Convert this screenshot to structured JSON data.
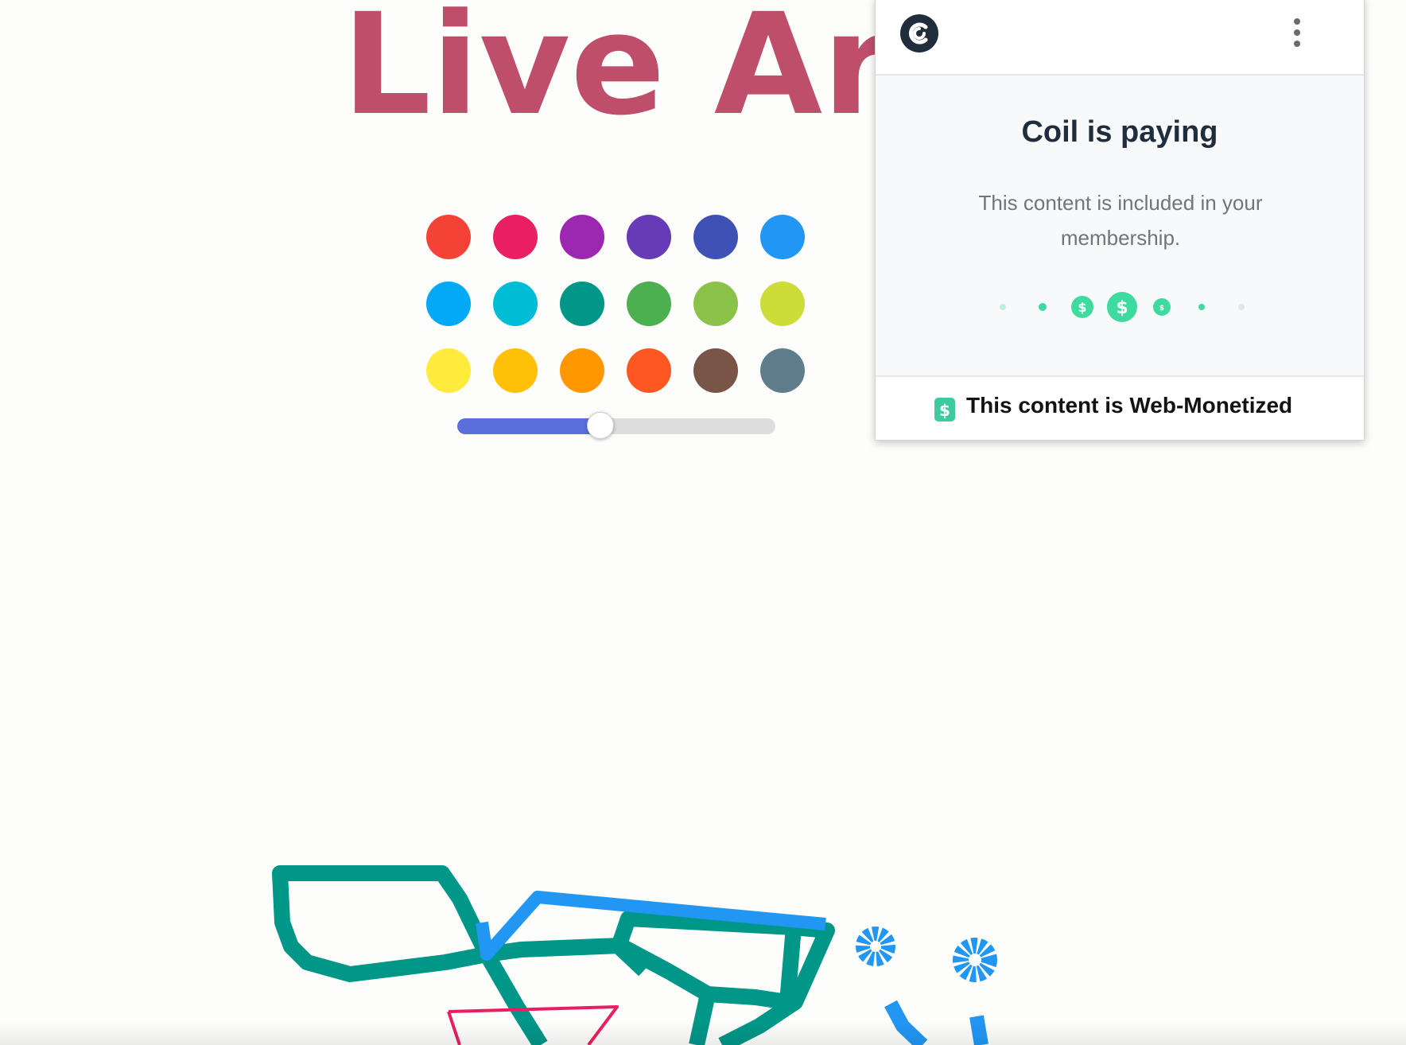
{
  "page": {
    "title": "Live Art",
    "background": "#fdfdfb",
    "title_color": "#bf4e6a"
  },
  "palette": {
    "colors": [
      "#f44336",
      "#e91e63",
      "#9c27b0",
      "#673ab7",
      "#3f51b5",
      "#2196f3",
      "#03a9f4",
      "#00bcd4",
      "#009688",
      "#4caf50",
      "#8bc34a",
      "#cddc39",
      "#ffeb3b",
      "#ffc107",
      "#ff9800",
      "#ff5722",
      "#795548",
      "#607d8b"
    ]
  },
  "brush_size_slider": {
    "value_fraction": 0.45,
    "fill_color": "#5b6fdc",
    "track_color": "#dddddd"
  },
  "drawing": {
    "stroke_colors": {
      "teal": "#009688",
      "blue": "#2196f3",
      "pink": "#e91e63"
    }
  },
  "coil_popup": {
    "heading": "Coil is paying",
    "message": "This content is included in your membership.",
    "footer_text": "This content is Web-Monetized",
    "icons": {
      "logo": "coil-logo-icon",
      "menu": "kebab-menu-icon",
      "badge": "dollar-badge-icon"
    },
    "accent_color": "#3ddb9f"
  }
}
